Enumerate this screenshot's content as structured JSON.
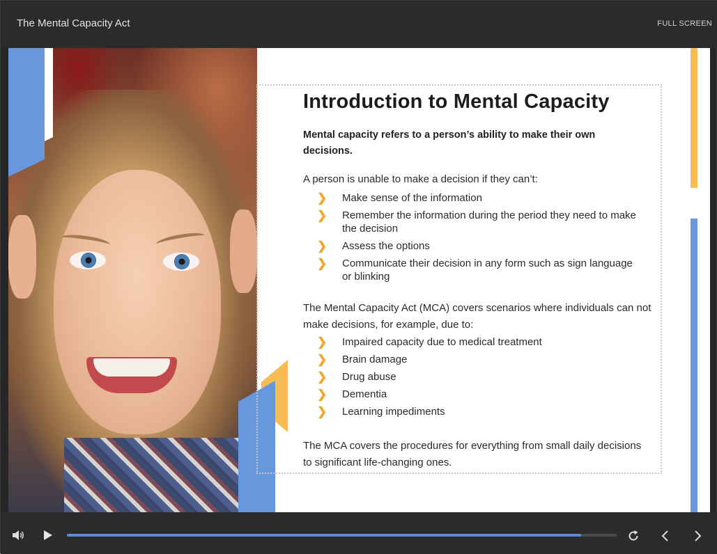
{
  "window": {
    "title": "The Mental Capacity Act",
    "fullscreen_label": "FULL SCREEN"
  },
  "slide": {
    "heading": "Introduction to Mental Capacity",
    "lead": "Mental capacity refers to a person’s ability to make their own decisions.",
    "para1": "A person is unable to make a decision if they can’t:",
    "bullets1": [
      "Make sense of the information",
      "Remember the information during the period they need to make the decision",
      "Assess the options",
      "Communicate their decision in any form such as sign language or blinking"
    ],
    "para2": "The Mental Capacity Act (MCA) covers scenarios where individuals can not make decisions, for example, due to:",
    "bullets2": [
      "Impaired capacity due to medical treatment",
      "Brain damage",
      "Drug abuse",
      "Dementia",
      "Learning impediments"
    ],
    "para3": "The MCA covers the procedures for everything from small daily decisions to significant life-changing ones.",
    "bullet_icon": "chevron-right-icon",
    "colors": {
      "accent_blue": "#6798dd",
      "accent_orange": "#f7bc55",
      "bullet_orange": "#f0a72c"
    }
  },
  "player": {
    "progress_fraction": 0.935,
    "icons": [
      "volume-icon",
      "play-icon",
      "replay-icon",
      "previous-icon",
      "next-icon"
    ]
  }
}
